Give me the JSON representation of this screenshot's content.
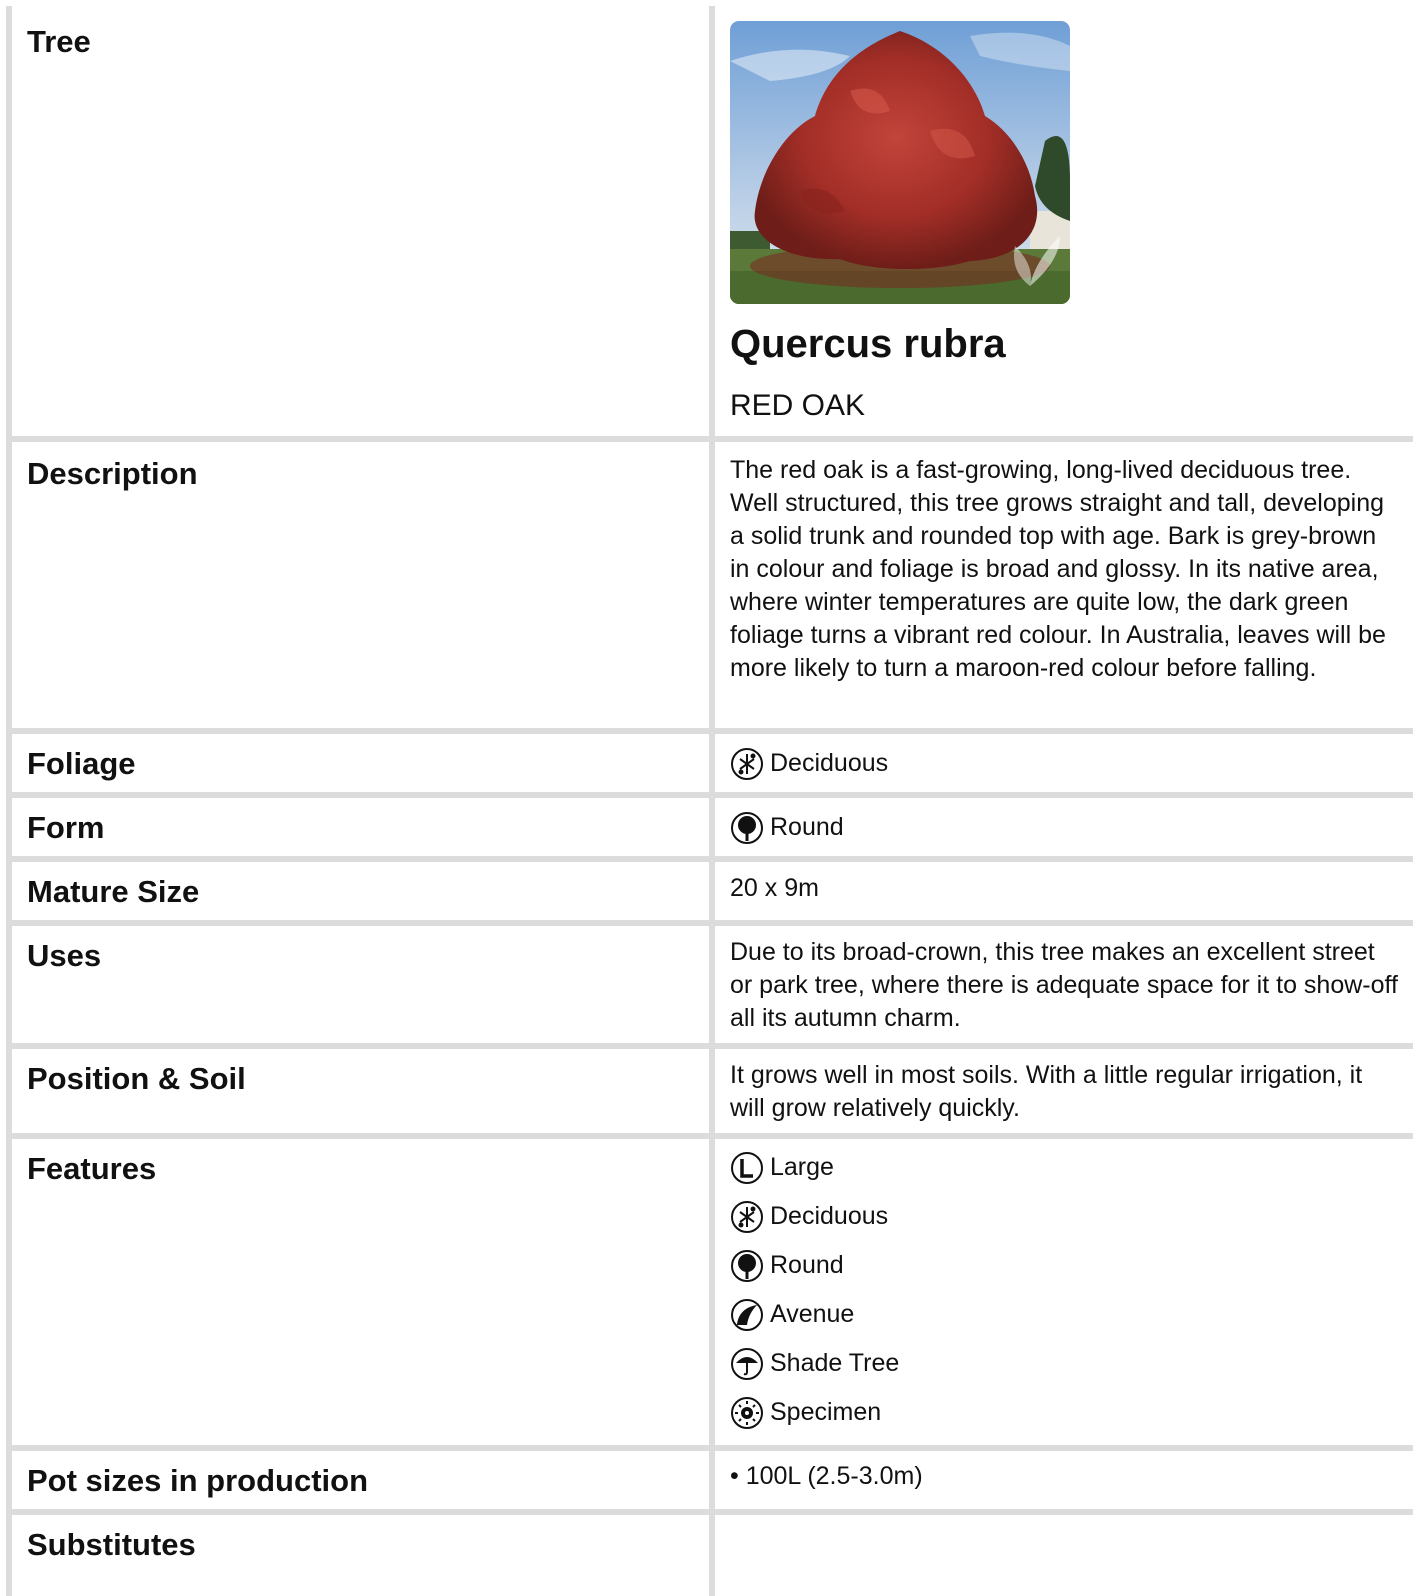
{
  "rows": {
    "tree": {
      "label": "Tree",
      "botanical_name": "Quercus rubra",
      "common_name": "RED OAK",
      "image_alt": "Red oak tree with autumn foliage"
    },
    "description": {
      "label": "Description",
      "value": "The red oak is a fast-growing, long-lived deciduous tree. Well structured, this tree grows straight and tall, developing a solid trunk and rounded top with age. Bark is grey-brown in colour and foliage is broad and glossy. In its native area, where winter temperatures are quite low, the dark green foliage turns a vibrant red colour. In Australia, leaves will be more likely to turn a maroon-red colour before falling."
    },
    "foliage": {
      "label": "Foliage",
      "value": "Deciduous",
      "icon": "deciduous-icon"
    },
    "form": {
      "label": "Form",
      "value": "Round",
      "icon": "round-icon"
    },
    "mature_size": {
      "label": "Mature Size",
      "value": "20 x 9m"
    },
    "uses": {
      "label": "Uses",
      "value": "Due to its broad-crown, this tree makes an excellent street or park tree, where there is adequate space for it to show-off all its autumn charm."
    },
    "position_soil": {
      "label": "Position & Soil",
      "value": "It grows well in most soils. With a little regular irrigation, it will grow relatively quickly."
    },
    "features": {
      "label": "Features",
      "items": [
        {
          "label": "Large",
          "icon": "large-icon"
        },
        {
          "label": "Deciduous",
          "icon": "deciduous-icon"
        },
        {
          "label": "Round",
          "icon": "round-icon"
        },
        {
          "label": "Avenue",
          "icon": "avenue-icon"
        },
        {
          "label": "Shade Tree",
          "icon": "shade-tree-icon"
        },
        {
          "label": "Specimen",
          "icon": "specimen-icon"
        }
      ]
    },
    "pot_sizes": {
      "label": "Pot sizes in production",
      "value": "• 100L (2.5-3.0m)"
    },
    "substitutes": {
      "label": "Substitutes",
      "value": ""
    }
  },
  "colors": {
    "border": "#dcdcdc",
    "text": "#111111",
    "foliage_red": "#a8302a"
  }
}
